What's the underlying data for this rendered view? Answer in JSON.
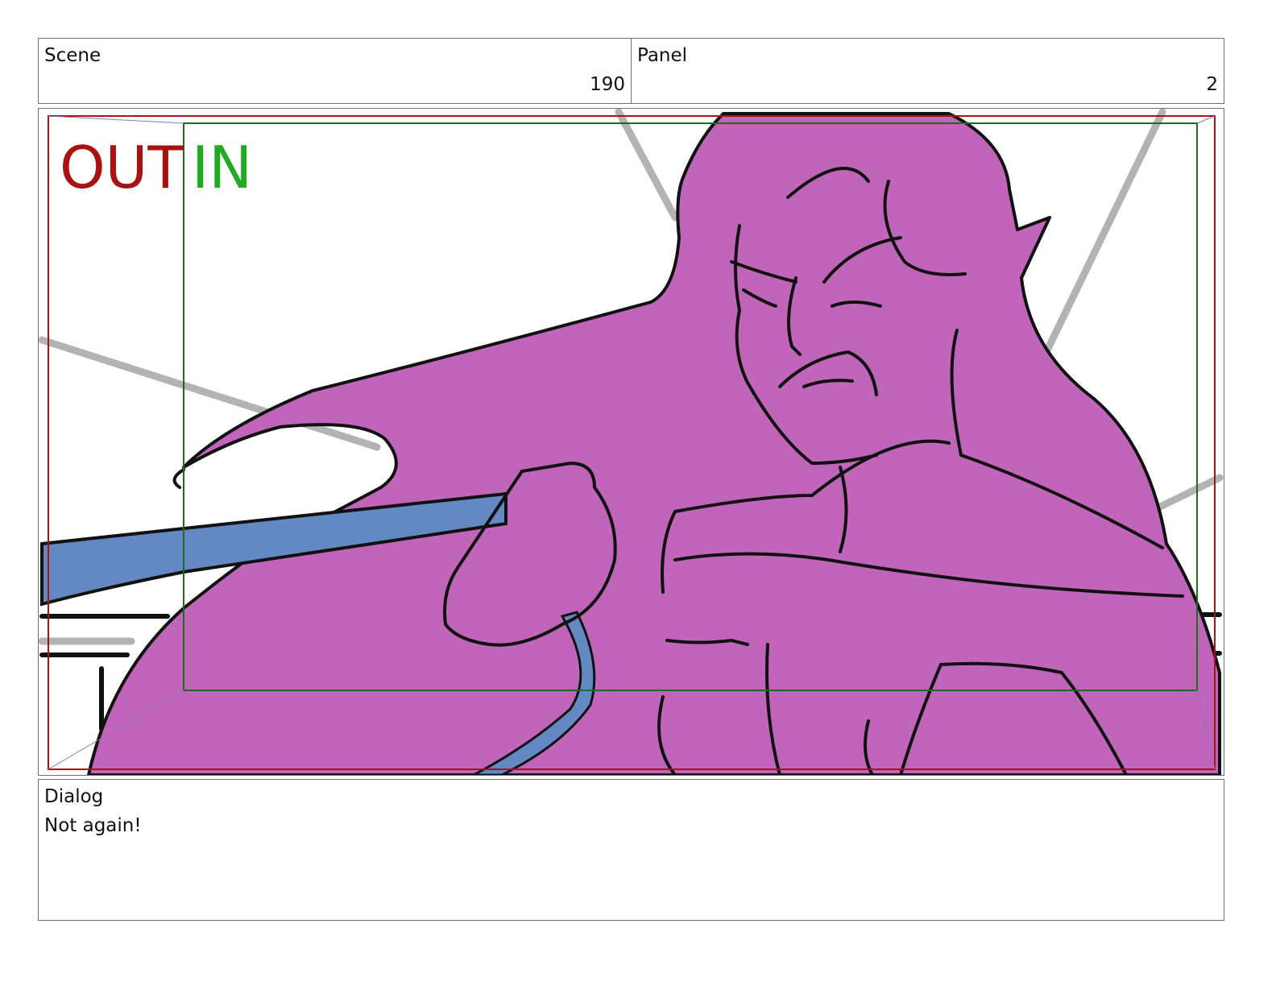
{
  "header": {
    "scene_label": "Scene",
    "scene_value": "190",
    "panel_label": "Panel",
    "panel_value": "2"
  },
  "frame": {
    "out_label": "OUT",
    "in_label": "IN",
    "colors": {
      "out": "#aa1111",
      "in": "#22aa22",
      "character_fill": "#c065b9",
      "pole_fill": "#6488c2",
      "ink": "#111111",
      "background_lines": "#b3b3b3"
    }
  },
  "dialog": {
    "label": "Dialog",
    "text": "Not again!"
  }
}
